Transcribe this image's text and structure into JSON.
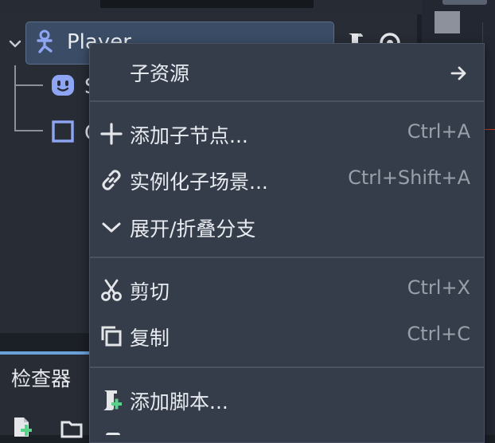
{
  "scene_tree": {
    "root": {
      "label": "Player",
      "icon": "character-body-icon"
    },
    "children": [
      {
        "label": "S",
        "icon": "sprite-face-icon"
      },
      {
        "label": "C",
        "icon": "collision-shape-icon"
      }
    ]
  },
  "inspector": {
    "title": "检查器"
  },
  "context_menu": {
    "items": [
      {
        "label": "子资源",
        "shortcut": "",
        "icon": "arrow-right-icon"
      },
      {
        "label": "添加子节点...",
        "shortcut": "Ctrl+A",
        "icon": "plus-icon"
      },
      {
        "label": "实例化子场景...",
        "shortcut": "Ctrl+Shift+A",
        "icon": "link-icon"
      },
      {
        "label": "展开/折叠分支",
        "shortcut": "",
        "icon": "chevron-down-icon"
      },
      {
        "label": "剪切",
        "shortcut": "Ctrl+X",
        "icon": "scissors-icon"
      },
      {
        "label": "复制",
        "shortcut": "Ctrl+C",
        "icon": "copy-icon"
      },
      {
        "label": "添加脚本...",
        "shortcut": "",
        "icon": "add-script-icon"
      }
    ]
  },
  "colors": {
    "accent": "#6aa1d8",
    "selection": "#3b4d66",
    "menu_bg": "#363d4a",
    "node_icon": "#8da5f3",
    "add_green": "#58d18b"
  }
}
